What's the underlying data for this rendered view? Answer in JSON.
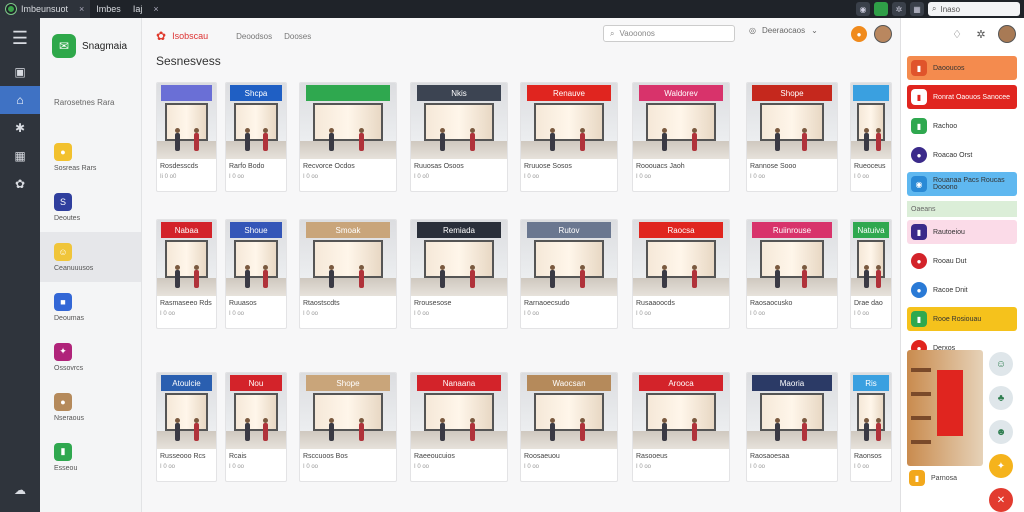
{
  "topbar": {
    "tab1": "Imbeunsuot",
    "tab2": "Imbes",
    "tab3": "Iaj",
    "search": "Inaso",
    "close": "×"
  },
  "sidebar": {
    "brand": "Snagmaia",
    "heading": "Rarosetnes Rara",
    "items": [
      {
        "label": "Sosreas Rars",
        "color": "#f2c12e",
        "icon": "●"
      },
      {
        "label": "Deoutes",
        "color": "#2f3f9e",
        "icon": "S"
      },
      {
        "label": "Ceanuuusos",
        "color": "#f0c53a",
        "icon": "☺"
      },
      {
        "label": "Deoumas",
        "color": "#3367d6",
        "icon": "■"
      },
      {
        "label": "Ossovrcs",
        "color": "#b0247a",
        "icon": "✦"
      },
      {
        "label": "Nseraous",
        "color": "#b58a5b",
        "icon": "●"
      },
      {
        "label": "Esseou",
        "color": "#2fa84f",
        "icon": "▮"
      }
    ]
  },
  "main": {
    "brand": "Isobscau",
    "nav": [
      "Deoodsos",
      "Dooses"
    ],
    "search_placeholder": "Vaooonos",
    "right_link": "Deeraocaos",
    "title": "Sesnesvess"
  },
  "cards": [
    [
      {
        "sign": "",
        "sign_color": "#6a6fd6",
        "cap": "Rosdesscds",
        "sub": "Ii 0 o0"
      },
      {
        "sign": "Shcpa",
        "sign_color": "#1f5fc4",
        "cap": "Rarfo Bodo",
        "sub": "I 0 oo"
      },
      {
        "sign": "",
        "sign_color": "#2fa84f",
        "cap": "Recvorce Ocdos",
        "sub": "I 0 oo"
      },
      {
        "sign": "Nkis",
        "sign_color": "#3c4452",
        "cap": "Ruuosas Osoos",
        "sub": "I 0 o0"
      },
      {
        "sign": "Renauve",
        "sign_color": "#e0251f",
        "cap": "Rruuose Sosos",
        "sub": "I 0 oo"
      },
      {
        "sign": "Waldorev",
        "sign_color": "#d8336b",
        "cap": "Rooouacs Jaoh",
        "sub": "I 0 oo"
      },
      {
        "sign": "Shope",
        "sign_color": "#c5281d",
        "cap": "Rannose Sooo",
        "sub": "I 0 oo"
      },
      {
        "sign": "",
        "sign_color": "#3aa0e0",
        "cap": "Rueoceus",
        "sub": "I 0 oo"
      }
    ],
    [
      {
        "sign": "Nabaa",
        "sign_color": "#d3232a",
        "cap": "Rasmaseeo Rds",
        "sub": "I 0 oo"
      },
      {
        "sign": "Shoue",
        "sign_color": "#3456b8",
        "cap": "Ruuasos",
        "sub": "I 0 oo"
      },
      {
        "sign": "Smoak",
        "sign_color": "#c9a57a",
        "cap": "Rtaostscdts",
        "sub": "I 0 oo"
      },
      {
        "sign": "Remiada",
        "sign_color": "#2a2f3a",
        "cap": "Rrousesose",
        "sub": "I 0 oo"
      },
      {
        "sign": "Rutov",
        "sign_color": "#6a7790",
        "cap": "Rarnaoecsudo",
        "sub": "I 0 oo"
      },
      {
        "sign": "Raocsa",
        "sign_color": "#e0251f",
        "cap": "Rusaaoocds",
        "sub": "I 0 oo"
      },
      {
        "sign": "Ruiinrouse",
        "sign_color": "#d8336b",
        "cap": "Raosaocusko",
        "sub": "I 0 oo"
      },
      {
        "sign": "Natuiva",
        "sign_color": "#2fa84f",
        "cap": "Drae dao",
        "sub": "I 0 oo"
      }
    ],
    [
      {
        "sign": "Atoulcie",
        "sign_color": "#2a5fb0",
        "cap": "Russeooo Rcs",
        "sub": "I 0 oo"
      },
      {
        "sign": "Nou",
        "sign_color": "#d3232a",
        "cap": "Rcais",
        "sub": "I 0 oo"
      },
      {
        "sign": "Shope",
        "sign_color": "#c9a57a",
        "cap": "Rsccuoos Bos",
        "sub": "I 0 oo"
      },
      {
        "sign": "Nanaana",
        "sign_color": "#d3232a",
        "cap": "Raeeoucuios",
        "sub": "I 0 oo"
      },
      {
        "sign": "Waocsan",
        "sign_color": "#b58a5b",
        "cap": "Roosaeuou",
        "sub": "I 0 oo"
      },
      {
        "sign": "Arooca",
        "sign_color": "#d3232a",
        "cap": "Rasooeus",
        "sub": "I 0 oo"
      },
      {
        "sign": "Maoria",
        "sign_color": "#2b3a66",
        "cap": "Raosaoesaa",
        "sub": "I 0 oo"
      },
      {
        "sign": "Ris",
        "sign_color": "#3aa0e0",
        "cap": "Raonsos",
        "sub": "I 0 oo"
      }
    ]
  ],
  "right_panel": {
    "items": [
      {
        "label": "Daooucos",
        "bg": "#f48b4e",
        "ic": "#e0542b",
        "icon": "▮"
      },
      {
        "label": "Ronrat Oaouos Sanocee",
        "bg": "#e0251f",
        "ic": "#fff",
        "icon": "▮",
        "dark": true
      },
      {
        "label": "Rachoo",
        "bg": "transparent",
        "ic": "#2fa84f",
        "icon": "▮"
      },
      {
        "label": "Roacao Orst",
        "bg": "transparent",
        "ic": "#3b2a8a",
        "icon": "●",
        "round": true
      },
      {
        "label": "Rouanaa Pacs Roucas Dooono",
        "bg": "#5fb8f0",
        "ic": "#2a8ad6",
        "icon": "◉"
      },
      {
        "label": "Oaeans",
        "bg": "#dbeed8",
        "ic": "",
        "icon": "",
        "section": true
      },
      {
        "label": "Rautoeiou",
        "bg": "#fbdbe8",
        "ic": "#3b2a8a",
        "icon": "▮"
      },
      {
        "label": "Rooau Dut",
        "bg": "transparent",
        "ic": "#d3232a",
        "icon": "●",
        "round": true
      },
      {
        "label": "Racoe Dnit",
        "bg": "transparent",
        "ic": "#2a7ad6",
        "icon": "●",
        "round": true
      },
      {
        "label": "Rooe Rosiouau",
        "bg": "#f5c21c",
        "ic": "#2fa84f",
        "icon": "▮"
      },
      {
        "label": "Derxos",
        "bg": "transparent",
        "ic": "#e0251f",
        "icon": "●",
        "round": true
      }
    ],
    "bottom_label": "Parnosa"
  }
}
